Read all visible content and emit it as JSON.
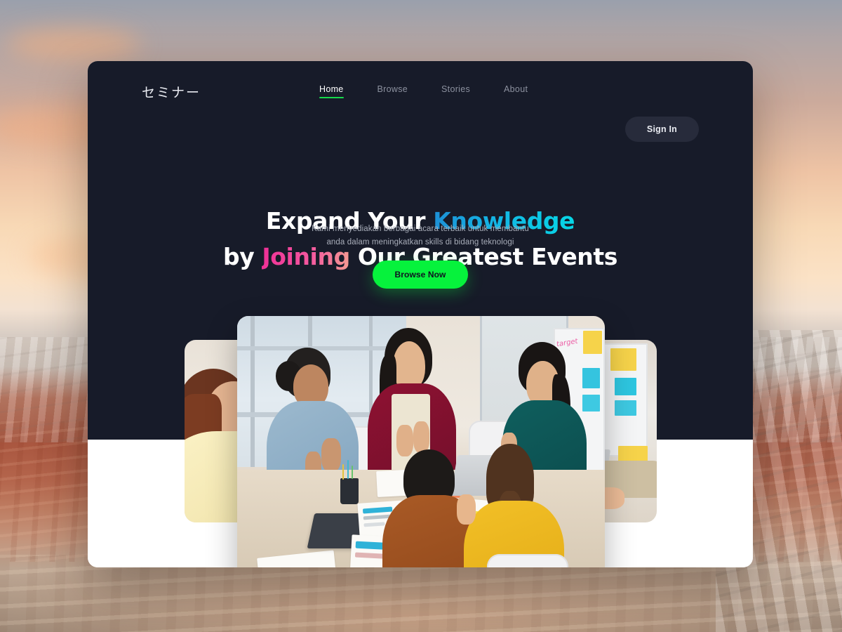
{
  "page": {
    "background_description": "desert sunset landscape photo",
    "card_bg_dark": "#171b29",
    "card_bg_light": "#ffffff"
  },
  "navbar": {
    "brand": "セミナー",
    "links": [
      {
        "label": "Home",
        "active": true
      },
      {
        "label": "Browse",
        "active": false
      },
      {
        "label": "Stories",
        "active": false
      },
      {
        "label": "About",
        "active": false
      }
    ],
    "active_underline_color": "#16d94a",
    "signin_label": "Sign In"
  },
  "hero": {
    "headline_line1_part1": "Expand Your ",
    "headline_line1_highlight": "Knowledge",
    "headline_line2_part1": "by ",
    "headline_line2_highlight": "Joining",
    "headline_line2_part2": " Our Greatest Events",
    "highlight_cyan_from": "#1d8fd6",
    "highlight_cyan_to": "#06d7e6",
    "highlight_pink_from": "#ee2f96",
    "highlight_pink_to": "#f49b92",
    "subtitle_line1": "Kami menyediakan berbagai acara terbaik untuk membantu",
    "subtitle_line2": "anda dalam meningkatkan skills di bidang teknologi",
    "cta_label": "Browse Now",
    "cta_color": "#06f23c"
  },
  "gallery": {
    "cards": [
      {
        "name": "photo-card-left",
        "alt": "woman in yellow blouse at meeting table"
      },
      {
        "name": "photo-card-main",
        "alt": "team of six people applauding around a meeting table"
      },
      {
        "name": "photo-card-right",
        "alt": "person working on laptop near whiteboard"
      }
    ],
    "board_text": "target"
  }
}
